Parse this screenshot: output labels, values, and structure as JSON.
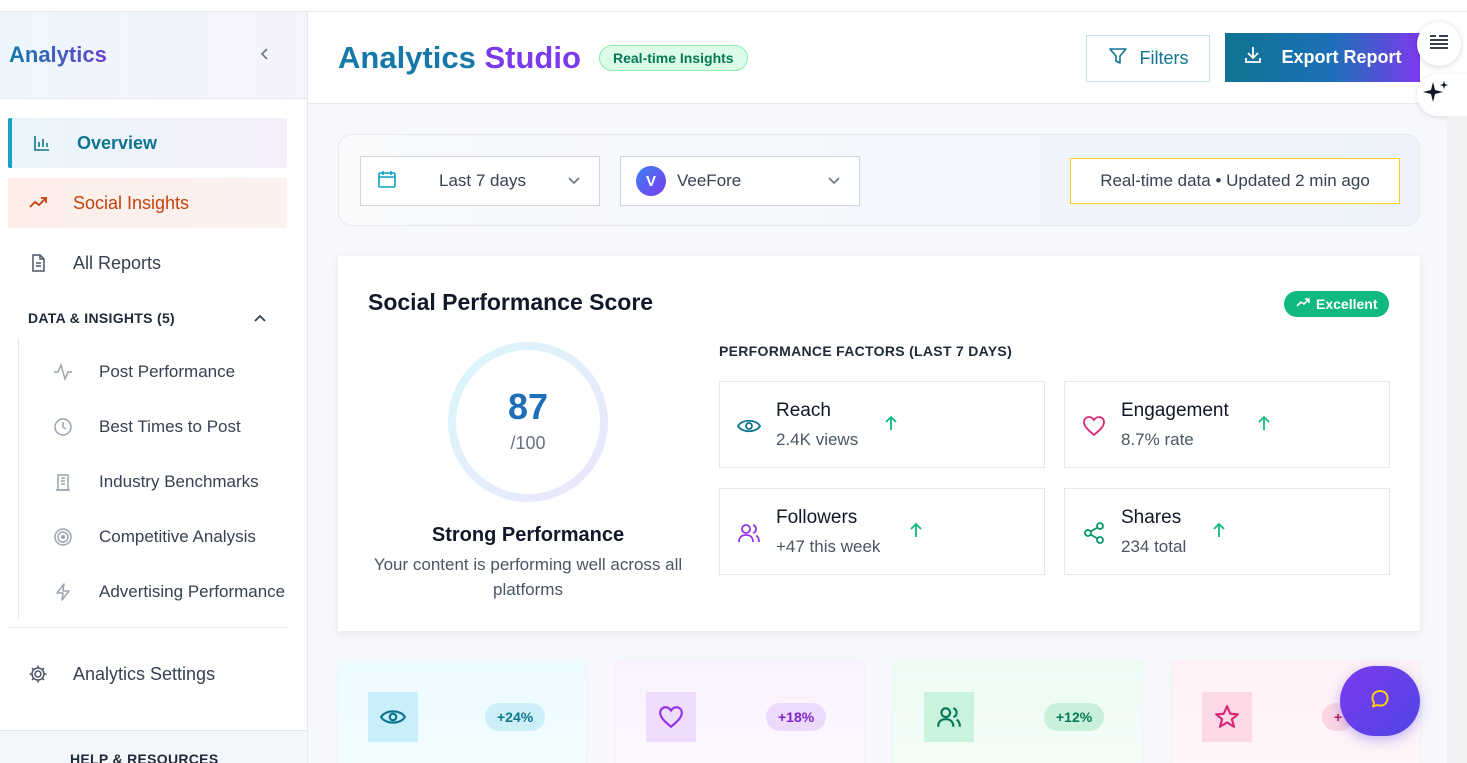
{
  "sidebar": {
    "title": "Analytics",
    "nav": [
      {
        "label": "Overview"
      },
      {
        "label": "Social Insights"
      },
      {
        "label": "All Reports"
      }
    ],
    "section_title": "DATA & INSIGHTS (5)",
    "sub_items": [
      {
        "label": "Post Performance"
      },
      {
        "label": "Best Times to Post"
      },
      {
        "label": "Industry Benchmarks"
      },
      {
        "label": "Competitive Analysis"
      },
      {
        "label": "Advertising Performance"
      }
    ],
    "settings_label": "Analytics Settings",
    "help_title": "HELP & RESOURCES"
  },
  "header": {
    "title_part1": "Analytics",
    "title_part2": "Studio",
    "badge": "Real-time Insights",
    "filters_label": "Filters",
    "export_label": "Export Report"
  },
  "filterbar": {
    "date_range": "Last 7 days",
    "account_initial": "V",
    "account": "VeeFore",
    "status": "Real-time data • Updated 2 min ago"
  },
  "score_card": {
    "title": "Social Performance Score",
    "rating_badge": "Excellent",
    "score": "87",
    "score_max": "/100",
    "score_fraction": 0.87,
    "verdict": "Strong Performance",
    "verdict_desc": "Your content is performing well across all platforms",
    "factors_title": "PERFORMANCE FACTORS (LAST 7 DAYS)",
    "factors": [
      {
        "name": "Reach",
        "value": "2.4K views",
        "icon": "eye-icon"
      },
      {
        "name": "Engagement",
        "value": "8.7% rate",
        "icon": "heart-icon"
      },
      {
        "name": "Followers",
        "value": "+47 this week",
        "icon": "users-icon"
      },
      {
        "name": "Shares",
        "value": "234 total",
        "icon": "share-icon"
      }
    ]
  },
  "stat_cards": [
    {
      "icon": "eye-icon",
      "change": "+24%"
    },
    {
      "icon": "heart-icon",
      "change": "+18%"
    },
    {
      "icon": "users-icon",
      "change": "+12%"
    },
    {
      "icon": "star-icon",
      "change": "+"
    }
  ],
  "colors": {
    "brand_teal": "#0e7490",
    "brand_purple": "#7c3aed",
    "success": "#10b981",
    "social_orange": "#c2410c"
  }
}
